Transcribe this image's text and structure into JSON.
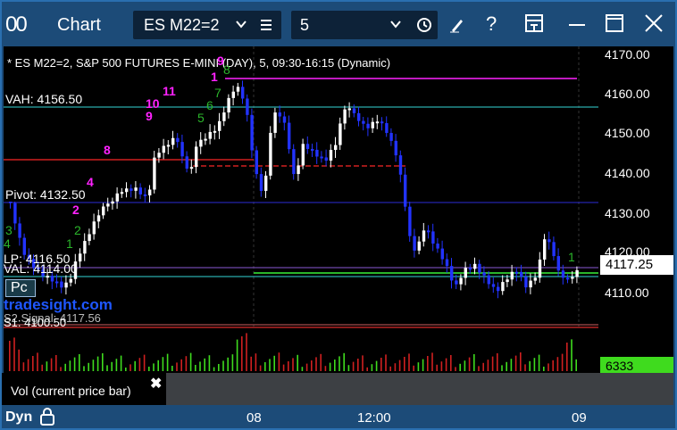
{
  "window": {
    "title": "Chart",
    "app_icon": "00",
    "instrument": "ES M22=2",
    "interval": "5",
    "colors": {
      "titlebar": "#1c4b78",
      "accent": "#2a6fb0"
    }
  },
  "toolbar_icons": [
    "instrument-chevron-icon",
    "instrument-menu-icon",
    "interval-chevron-icon",
    "clock-icon",
    "edit-icon",
    "help-icon",
    "dock-icon",
    "minimize-icon",
    "maximize-icon",
    "close-icon"
  ],
  "chart": {
    "info_line": "* ES M22=2, S&P 500 FUTURES E-MINI (DAY), 5, 09:30-16:15 (Dynamic)",
    "brand": "tradesight.com",
    "pc_label": "Pc",
    "annotations": {
      "vah": "VAH: 4156.50",
      "pivot": "Pivot: 4132.50",
      "lp": "LP: 4116.50",
      "val": "VAL: 4114.00",
      "s2": "S2 Signal: 4117.56",
      "s1": "S1: 4100.50"
    },
    "counts_magenta": [
      "10",
      "11",
      "9",
      "8",
      "2",
      "4",
      "1",
      "9"
    ],
    "counts_green": [
      "1",
      "2",
      "3",
      "4",
      "5",
      "6",
      "7",
      "8",
      "1"
    ],
    "price_ticks": [
      "4170.00",
      "4160.00",
      "4150.00",
      "4140.00",
      "4130.00",
      "4120.00",
      "4110.00"
    ],
    "last_price": "4117.25",
    "volume_last": "6333",
    "x_labels": [
      "08",
      "12:00",
      "09"
    ],
    "colors": {
      "up": "#ffffff",
      "down": "#2233ff",
      "vah": "#33d6d6",
      "pivot": "#2b2bd6",
      "resistance": "#d02020",
      "magenta": "#ff22ff",
      "green": "#2bb52b"
    }
  },
  "legend": {
    "label": "Vol (current price bar)",
    "close": "✖"
  },
  "footer": {
    "mode": "Dyn"
  }
}
